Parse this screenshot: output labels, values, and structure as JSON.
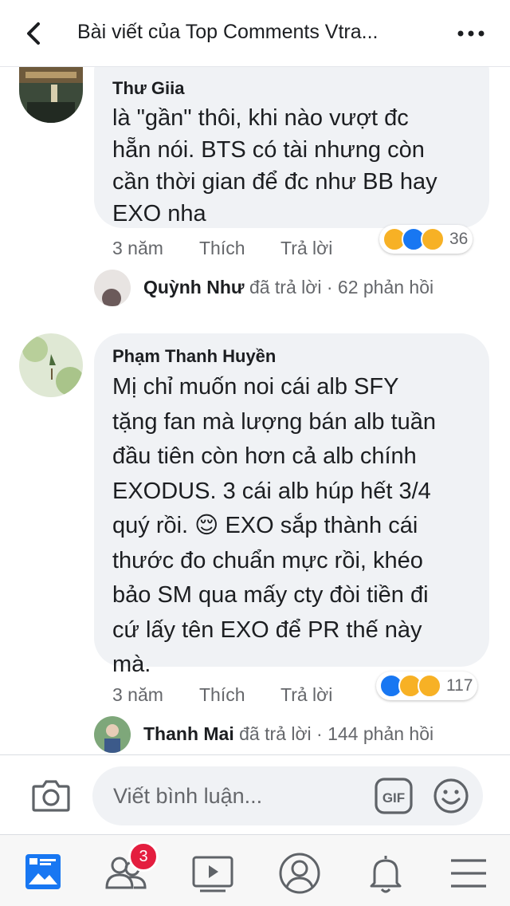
{
  "header": {
    "title": "Bài viết của Top Comments Vtra..."
  },
  "comments": [
    {
      "author": "Thư Giia",
      "lines": [
        "là \"gần\" thôi, khi nào vượt đc",
        "hẵn nói. BTS có tài nhưng còn",
        "cần thời gian để đc như BB hay",
        "EXO nha"
      ],
      "time": "3 năm",
      "like_label": "Thích",
      "reply_label": "Trả lời",
      "reactions": [
        "haha",
        "like",
        "sad"
      ],
      "reaction_count": "36",
      "reply": {
        "name": "Quỳnh Như",
        "action": "đã trả lời",
        "separator": "·",
        "count": "62 phản hồi"
      }
    },
    {
      "author": "Phạm Thanh Huyền",
      "lines": [
        "Mị chỉ muốn noi cái alb SFY",
        "tặng fan mà lượng bán alb tuần",
        "đầu tiên còn hơn cả alb chính",
        "EXODUS. 3 cái alb húp hết 3/4",
        "quý rồi. 😌 EXO sắp thành cái",
        "thước đo chuẩn mực rồi, khéo",
        "bảo SM qua mấy cty đòi tiền đi",
        "cứ lấy tên EXO để PR thế này",
        "mà."
      ],
      "time": "3 năm",
      "like_label": "Thích",
      "reply_label": "Trả lời",
      "reactions": [
        "like",
        "haha",
        "sad"
      ],
      "reaction_count": "117",
      "reply": {
        "name": "Thanh Mai",
        "action": "đã trả lời",
        "separator": "·",
        "count": "144 phản hồi"
      }
    }
  ],
  "composer": {
    "placeholder": "Viết bình luận...",
    "gif_label": "GIF"
  },
  "tabbar": {
    "friends_badge": "3"
  },
  "colors": {
    "accent": "#1877f2",
    "bubble": "#f0f2f5",
    "badge": "#e41e3f",
    "reaction_yellow": "#f7b125"
  }
}
